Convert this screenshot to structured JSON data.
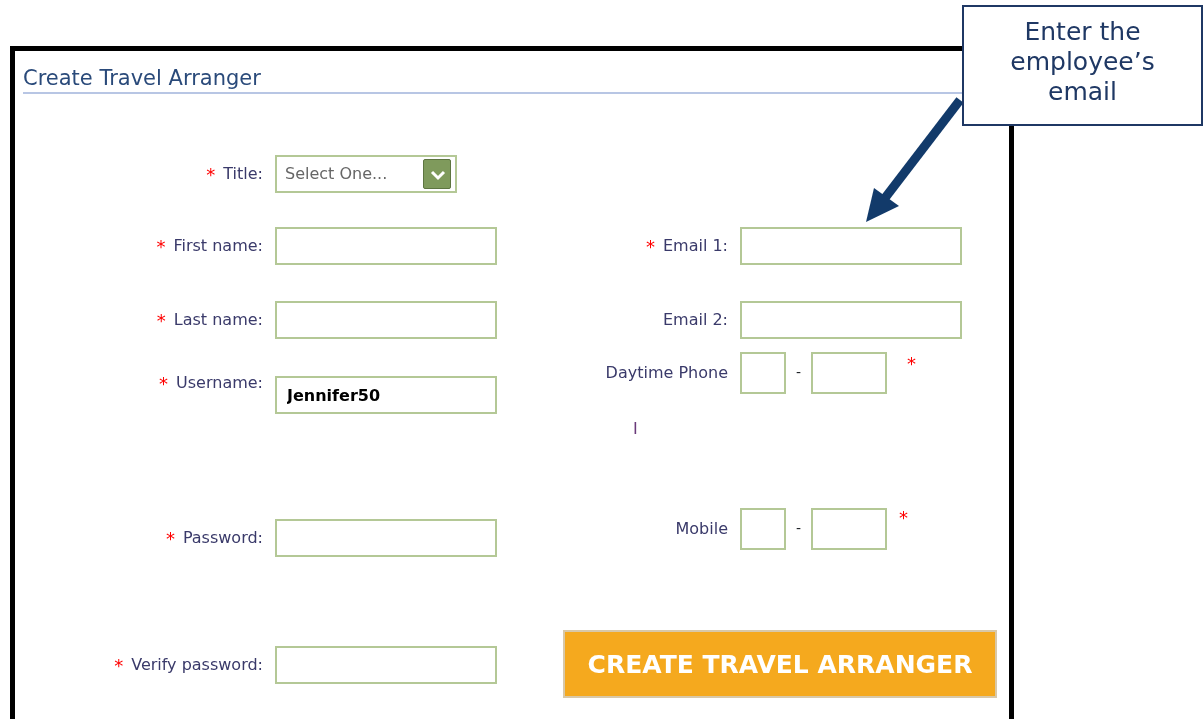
{
  "form": {
    "title": "Create Travel Arranger",
    "left_fields": [
      {
        "kind": "select",
        "label": "Title:",
        "required_mark": "*",
        "value": "Select One..."
      },
      {
        "kind": "text",
        "label": "First name:",
        "required_mark": "*"
      },
      {
        "kind": "text",
        "label": "Last name:",
        "required_mark": "*"
      },
      {
        "kind": "text",
        "label": "Username:",
        "required_mark": "*",
        "value": "Jennifer50"
      },
      {
        "kind": "text",
        "label": "Password:",
        "required_mark": "*"
      },
      {
        "kind": "text",
        "label": "Verify password:",
        "required_mark": "*"
      }
    ],
    "right_fields": [
      {
        "kind": "text",
        "label": "Email 1:",
        "required_mark": "*"
      },
      {
        "kind": "text",
        "label": "Email 2:"
      },
      {
        "kind": "phone",
        "label": "Daytime Phone",
        "required_mark": "*",
        "separator": "-"
      },
      {
        "kind": "phone",
        "label": "Mobile",
        "required_mark": "*",
        "separator": "-"
      }
    ],
    "cursor_mark": "I",
    "submit_button": "CREATE TRAVEL ARRANGER"
  },
  "callout": {
    "text": "Enter the employee’s email"
  }
}
